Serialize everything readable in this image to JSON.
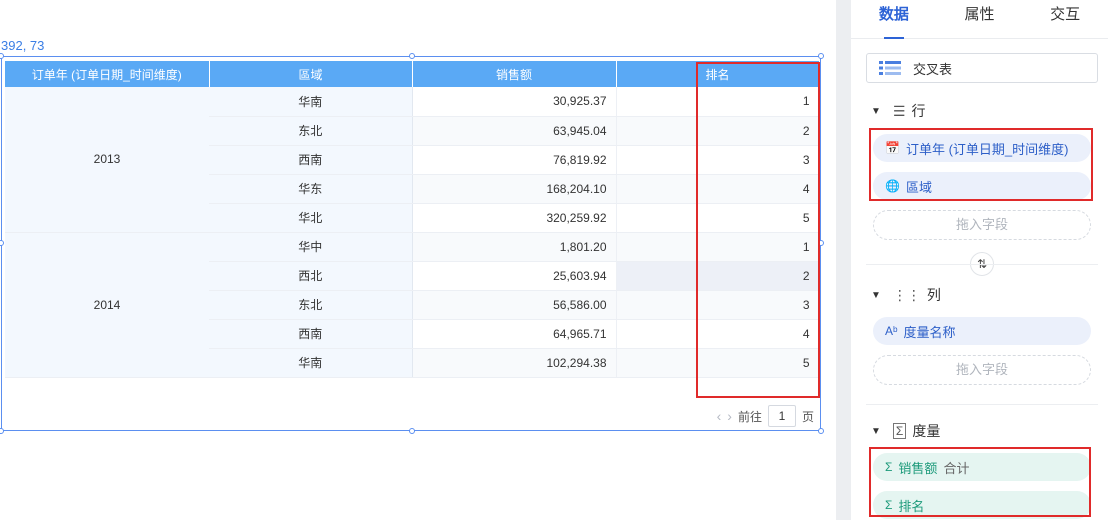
{
  "canvas": {
    "coordinates": "392, 73"
  },
  "table": {
    "headers": [
      "订单年 (订单日期_时间维度)",
      "區域",
      "销售额",
      "排名"
    ],
    "groups": [
      {
        "year": "2013",
        "rows": [
          {
            "region": "华南",
            "sales": "30,925.37",
            "rank": "1"
          },
          {
            "region": "东北",
            "sales": "63,945.04",
            "rank": "2"
          },
          {
            "region": "西南",
            "sales": "76,819.92",
            "rank": "3"
          },
          {
            "region": "华东",
            "sales": "168,204.10",
            "rank": "4"
          },
          {
            "region": "华北",
            "sales": "320,259.92",
            "rank": "5"
          }
        ]
      },
      {
        "year": "2014",
        "rows": [
          {
            "region": "华中",
            "sales": "1,801.20",
            "rank": "1"
          },
          {
            "region": "西北",
            "sales": "25,603.94",
            "rank": "2"
          },
          {
            "region": "东北",
            "sales": "56,586.00",
            "rank": "3"
          },
          {
            "region": "西南",
            "sales": "64,965.71",
            "rank": "4"
          },
          {
            "region": "华南",
            "sales": "102,294.38",
            "rank": "5"
          }
        ]
      }
    ]
  },
  "pager": {
    "goto_label": "前往",
    "page": "1",
    "page_label": "页"
  },
  "panel": {
    "tabs": [
      "数据",
      "属性",
      "交互"
    ],
    "chart_type": "交叉表",
    "rows_section": {
      "title": "行",
      "fields": [
        "订单年 (订单日期_时间维度)",
        "區域"
      ],
      "drop_hint": "拖入字段"
    },
    "cols_section": {
      "title": "列",
      "fields": [
        "度量名称"
      ],
      "drop_hint": "拖入字段"
    },
    "measures_section": {
      "title": "度量",
      "fields": [
        {
          "name": "销售额",
          "agg": "合计"
        },
        {
          "name": "排名",
          "agg": ""
        }
      ]
    }
  },
  "colors": {
    "accent": "#2d63d6",
    "header_bg": "#5aa9f5",
    "highlight_border": "#e02a2a",
    "measure_green": "#1c9a7a"
  }
}
